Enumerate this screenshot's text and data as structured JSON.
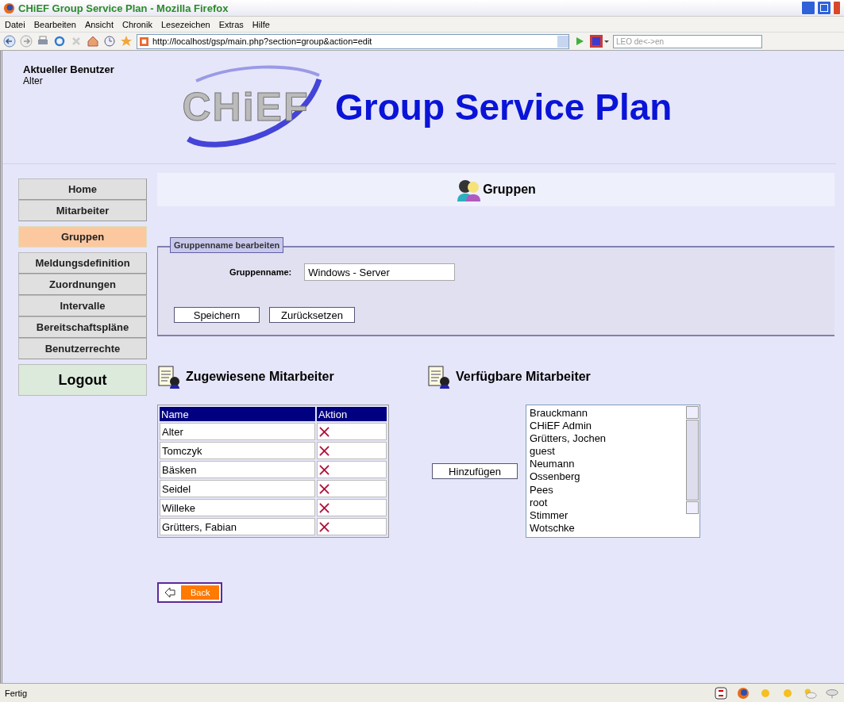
{
  "window": {
    "title": "CHiEF Group Service Plan - Mozilla Firefox"
  },
  "menu": [
    "Datei",
    "Bearbeiten",
    "Ansicht",
    "Chronik",
    "Lesezeichen",
    "Extras",
    "Hilfe"
  ],
  "toolbar": {
    "url": "http://localhost/gsp/main.php?section=group&action=edit",
    "search_placeholder": "LEO de<->en"
  },
  "user": {
    "label": "Aktueller Benutzer",
    "name": "Alter"
  },
  "header": {
    "logo": "CHiEF",
    "title": "Group Service Plan"
  },
  "nav": [
    {
      "label": "Home",
      "selected": false
    },
    {
      "label": "Mitarbeiter",
      "selected": false
    },
    {
      "label": "Gruppen",
      "selected": true
    },
    {
      "label": "Meldungsdefinition",
      "selected": false
    },
    {
      "label": "Zuordnungen",
      "selected": false
    },
    {
      "label": "Intervalle",
      "selected": false
    },
    {
      "label": "Bereitschaftspläne",
      "selected": false
    },
    {
      "label": "Benutzerrechte",
      "selected": false
    }
  ],
  "logout": "Logout",
  "section_title": "Gruppen",
  "form": {
    "legend": "Gruppenname bearbeiten",
    "label": "Gruppenname:",
    "value": "Windows - Server",
    "buttons": [
      "Speichern",
      "Zurücksetzen"
    ]
  },
  "assigned": {
    "heading": "Zugewiesene Mitarbeiter",
    "columns": [
      "Name",
      "Aktion"
    ],
    "rows": [
      "Alter",
      "Tomczyk",
      "Bäsken",
      "Seidel",
      "Willeke",
      "Grütters, Fabian"
    ]
  },
  "available": {
    "heading": "Verfügbare Mitarbeiter",
    "add_button": "Hinzufügen",
    "items": [
      "Brauckmann",
      "CHiEF Admin",
      "Grütters, Jochen",
      "guest",
      "Neumann",
      "Ossenberg",
      "Pees",
      "root",
      "Stimmer",
      "Wotschke"
    ]
  },
  "back_button": "Back",
  "status_bar": "Fertig"
}
